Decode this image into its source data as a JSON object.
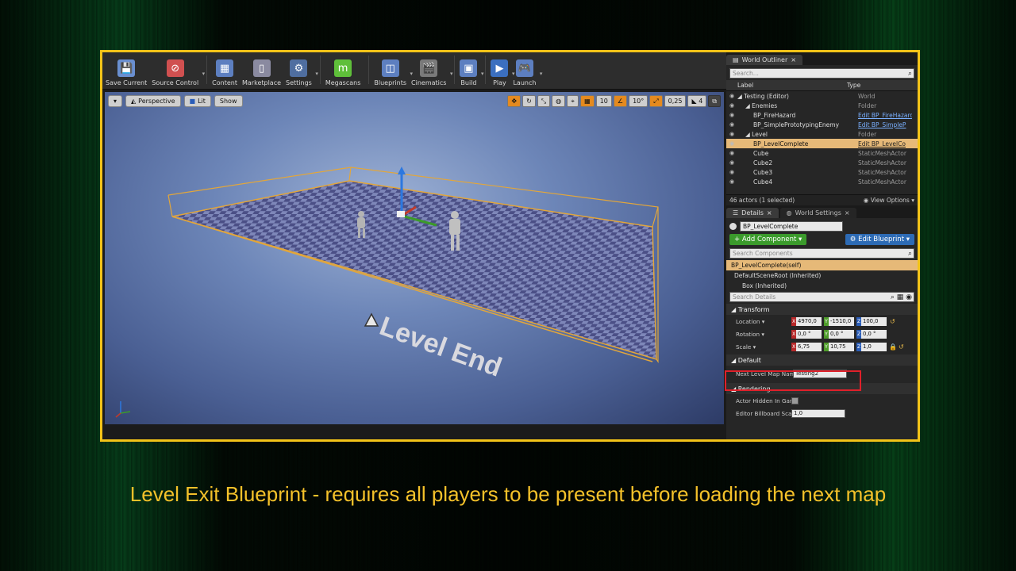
{
  "toolbar": {
    "items": [
      {
        "label": "Save Current",
        "icon": "save-icon",
        "color": "#6a8fd0",
        "glyph": "💾"
      },
      {
        "label": "Source Control",
        "icon": "source-control-icon",
        "color": "#d05050",
        "glyph": "⊘",
        "drop": true
      },
      {
        "label": "Content",
        "icon": "content-icon",
        "color": "#5d7fc0",
        "glyph": "▦"
      },
      {
        "label": "Marketplace",
        "icon": "marketplace-icon",
        "color": "#8a8aa0",
        "glyph": "▯"
      },
      {
        "label": "Settings",
        "icon": "settings-icon",
        "color": "#4f6ea0",
        "glyph": "⚙",
        "drop": true
      },
      {
        "label": "Megascans",
        "icon": "megascans-icon",
        "color": "#5fbf3a",
        "glyph": "m"
      },
      {
        "label": "Blueprints",
        "icon": "blueprints-icon",
        "color": "#5d7fc0",
        "glyph": "◫",
        "drop": true
      },
      {
        "label": "Cinematics",
        "icon": "cinematics-icon",
        "color": "#7a7a7a",
        "glyph": "🎬",
        "drop": true
      },
      {
        "label": "Build",
        "icon": "build-icon",
        "color": "#5d7fc0",
        "glyph": "▣",
        "drop": true
      },
      {
        "label": "Play",
        "icon": "play-icon",
        "color": "#3b6fbf",
        "glyph": "▶",
        "drop": true
      },
      {
        "label": "Launch",
        "icon": "launch-icon",
        "color": "#5d7fc0",
        "glyph": "🎮",
        "drop": true
      }
    ]
  },
  "viewport": {
    "perspective": "Perspective",
    "lit": "Lit",
    "show": "Show",
    "grid_snap": "10",
    "rot_snap": "10°",
    "scale_snap": "0,25",
    "camera_speed": "4",
    "floor_text": "Level End"
  },
  "outliner": {
    "tab": "World Outliner",
    "search_placeholder": "Search...",
    "col_label": "Label",
    "col_type": "Type",
    "rows": [
      {
        "name": "Testing (Editor)",
        "type": "World",
        "indent": 0,
        "link": false
      },
      {
        "name": "Enemies",
        "type": "Folder",
        "indent": 1,
        "link": false
      },
      {
        "name": "BP_FireHazard",
        "type": "Edit BP_FireHazard",
        "indent": 2,
        "link": true
      },
      {
        "name": "BP_SimplePrototypingEnemy",
        "type": "Edit BP_SimpleP",
        "indent": 2,
        "link": true
      },
      {
        "name": "Level",
        "type": "Folder",
        "indent": 1,
        "link": false
      },
      {
        "name": "BP_LevelComplete",
        "type": "Edit BP_LevelCo",
        "indent": 2,
        "link": true,
        "selected": true
      },
      {
        "name": "Cube",
        "type": "StaticMeshActor",
        "indent": 2,
        "link": false
      },
      {
        "name": "Cube2",
        "type": "StaticMeshActor",
        "indent": 2,
        "link": false
      },
      {
        "name": "Cube3",
        "type": "StaticMeshActor",
        "indent": 2,
        "link": false
      },
      {
        "name": "Cube4",
        "type": "StaticMeshActor",
        "indent": 2,
        "link": false
      }
    ],
    "actor_count": "46 actors (1 selected)",
    "view_options": "View Options"
  },
  "details": {
    "tab_details": "Details",
    "tab_world_settings": "World Settings",
    "actor_name": "BP_LevelComplete",
    "add_component": "+ Add Component",
    "edit_blueprint": "Edit Blueprint",
    "search_components": "Search Components",
    "components": [
      {
        "label": "BP_LevelComplete(self)",
        "selected": true
      },
      {
        "label": "DefaultSceneRoot (Inherited)",
        "selected": false
      },
      {
        "label": "Box (Inherited)",
        "selected": false
      }
    ],
    "search_details": "Search Details",
    "transform_title": "Transform",
    "location_label": "Location",
    "location": {
      "x": "4970,0",
      "y": "-1510,0",
      "z": "100,0"
    },
    "rotation_label": "Rotation",
    "rotation": {
      "x": "0,0 °",
      "y": "0,0 °",
      "z": "0,0 °"
    },
    "scale_label": "Scale",
    "scale": {
      "x": "6,75",
      "y": "10,75",
      "z": "1,0"
    },
    "default_title": "Default",
    "next_level_label": "Next Level Map Name",
    "next_level_value": "Testing2",
    "rendering_title": "Rendering",
    "hidden_label": "Actor Hidden In Game",
    "billboard_label": "Editor Billboard Scale",
    "billboard_value": "1,0"
  },
  "caption": "Level Exit Blueprint - requires all players to be present before loading the next map"
}
